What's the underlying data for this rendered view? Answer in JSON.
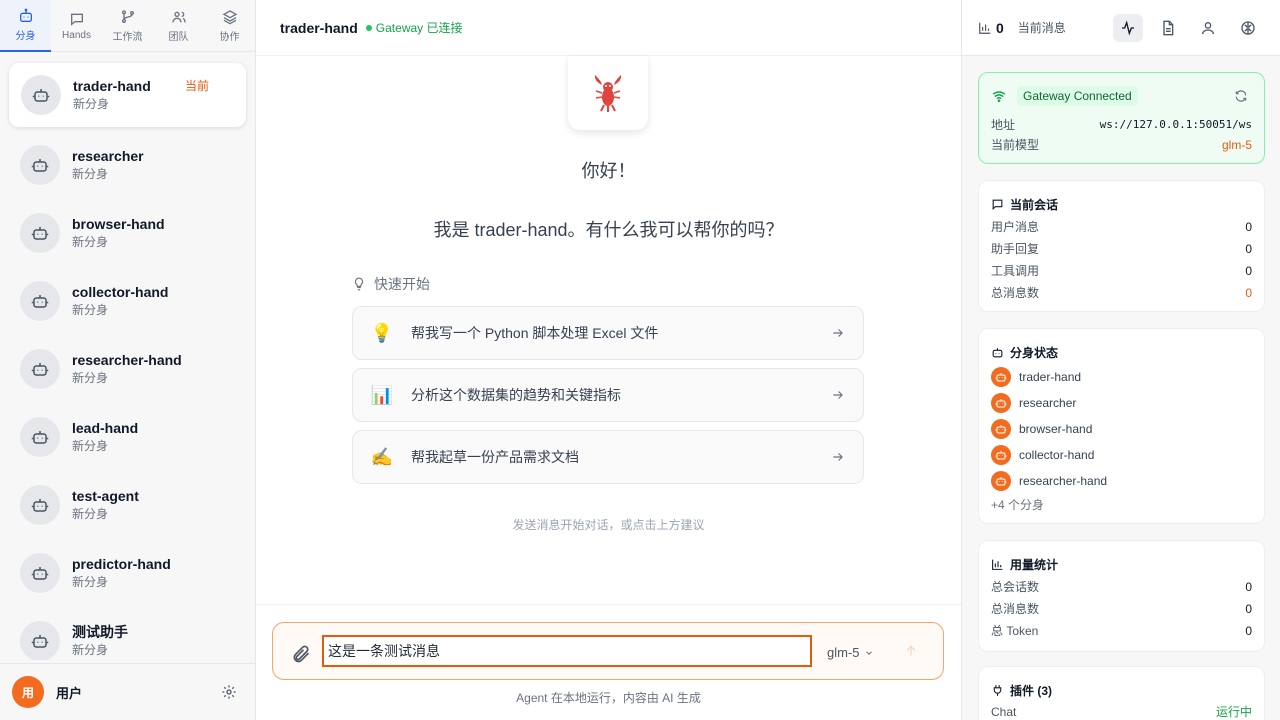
{
  "nav_tabs": [
    {
      "label": "分身",
      "icon": "bot-icon"
    },
    {
      "label": "Hands",
      "icon": "chat-icon"
    },
    {
      "label": "工作流",
      "icon": "workflow-icon"
    },
    {
      "label": "团队",
      "icon": "team-icon"
    },
    {
      "label": "协作",
      "icon": "layers-icon"
    }
  ],
  "agents": [
    {
      "name": "trader-hand",
      "sub": "新分身",
      "badge": "当前"
    },
    {
      "name": "researcher",
      "sub": "新分身"
    },
    {
      "name": "browser-hand",
      "sub": "新分身"
    },
    {
      "name": "collector-hand",
      "sub": "新分身"
    },
    {
      "name": "researcher-hand",
      "sub": "新分身"
    },
    {
      "name": "lead-hand",
      "sub": "新分身"
    },
    {
      "name": "test-agent",
      "sub": "新分身"
    },
    {
      "name": "predictor-hand",
      "sub": "新分身"
    },
    {
      "name": "测试助手",
      "sub": "新分身"
    }
  ],
  "user": {
    "avatar_text": "用",
    "name": "用户"
  },
  "main": {
    "title": "trader-hand",
    "gateway_status": "Gateway 已连接",
    "greeting": "你好！",
    "intro": "我是 trader-hand。有什么我可以帮你的吗？",
    "quick_start": "快速开始",
    "suggestions": [
      {
        "emoji": "💡",
        "text": "帮我写一个 Python 脚本处理 Excel 文件"
      },
      {
        "emoji": "📊",
        "text": "分析这个数据集的趋势和关键指标"
      },
      {
        "emoji": "✍️",
        "text": "帮我起草一份产品需求文档"
      }
    ],
    "hint": "发送消息开始对话，或点击上方建议",
    "input_value": "这是一条测试消息",
    "model": "glm-5",
    "footer": "Agent 在本地运行，内容由 AI 生成"
  },
  "right": {
    "message_count": "0",
    "current_label": "当前消息",
    "gateway": {
      "status": "Gateway Connected",
      "address_label": "地址",
      "address": "ws://127.0.0.1:50051/ws",
      "model_label": "当前模型",
      "model": "glm-5"
    },
    "session": {
      "title": "当前会话",
      "rows": [
        {
          "label": "用户消息",
          "value": "0"
        },
        {
          "label": "助手回复",
          "value": "0"
        },
        {
          "label": "工具调用",
          "value": "0"
        },
        {
          "label": "总消息数",
          "value": "0"
        }
      ]
    },
    "hands": {
      "title": "分身状态",
      "items": [
        "trader-hand",
        "researcher",
        "browser-hand",
        "collector-hand",
        "researcher-hand"
      ],
      "more": "+4 个分身"
    },
    "usage": {
      "title": "用量统计",
      "rows": [
        {
          "label": "总会话数",
          "value": "0"
        },
        {
          "label": "总消息数",
          "value": "0"
        },
        {
          "label": "总 Token",
          "value": "0"
        }
      ]
    },
    "plugins": {
      "title": "插件 (3)",
      "rows": [
        {
          "label": "Chat",
          "value": "运行中"
        }
      ]
    }
  },
  "colors": {
    "accent": "#2563eb",
    "brand": "#ea580c",
    "success": "#16a34a"
  }
}
